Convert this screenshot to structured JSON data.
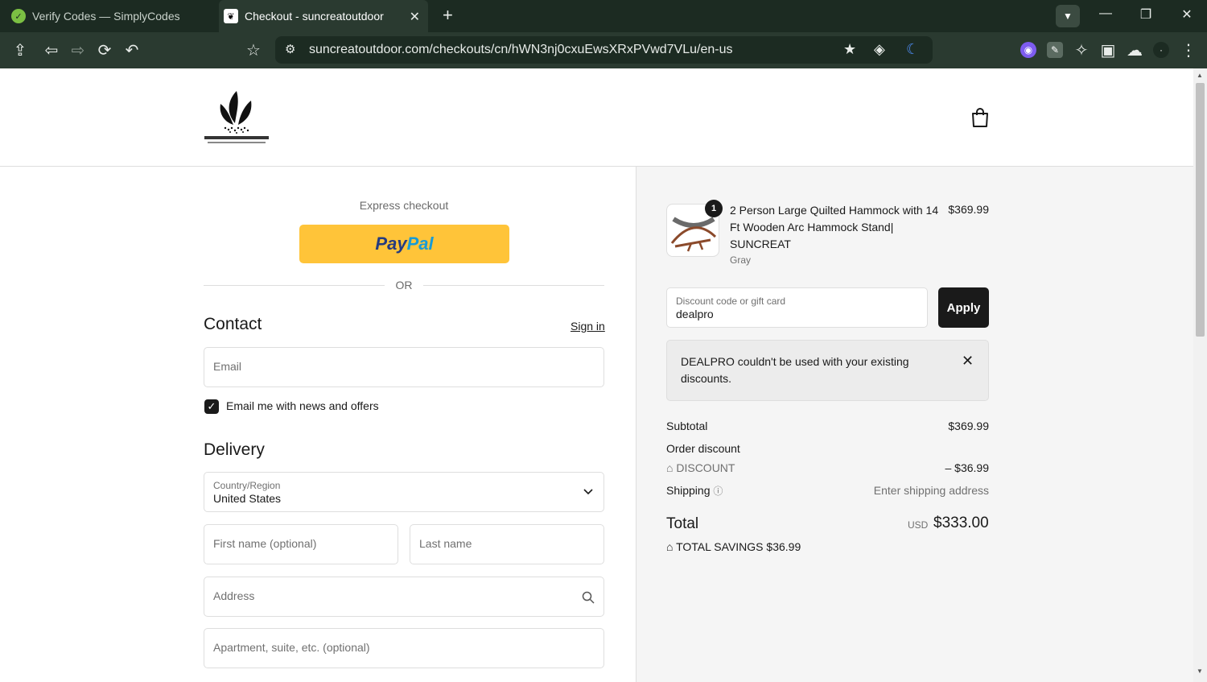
{
  "browser": {
    "tabs": [
      {
        "title": "Verify Codes — SimplyCodes",
        "active": false
      },
      {
        "title": "Checkout - suncreatoutdoor",
        "active": true
      }
    ],
    "url": "suncreatoutdoor.com/checkouts/cn/hWN3nj0cxuEwsXRxPVwd7VLu/en-us"
  },
  "checkout": {
    "express_title": "Express checkout",
    "paypal_part1": "Pay",
    "paypal_part2": "Pal",
    "or_label": "OR",
    "contact": {
      "title": "Contact",
      "sign_in": "Sign in",
      "email_placeholder": "Email",
      "newsletter_label": "Email me with news and offers",
      "newsletter_checked": true
    },
    "delivery": {
      "title": "Delivery",
      "country_label": "Country/Region",
      "country_value": "United States",
      "first_name_placeholder": "First name (optional)",
      "last_name_placeholder": "Last name",
      "address_placeholder": "Address",
      "apartment_placeholder": "Apartment, suite, etc. (optional)"
    }
  },
  "summary": {
    "product": {
      "quantity": "1",
      "name": "2 Person Large Quilted Hammock with 14 Ft Wooden Arc Hammock Stand| SUNCREAT",
      "variant": "Gray",
      "price": "$369.99"
    },
    "discount_field_label": "Discount code or gift card",
    "discount_field_value": "dealpro",
    "apply_label": "Apply",
    "notice": "DEALPRO couldn't be used with your existing discounts.",
    "subtotal_label": "Subtotal",
    "subtotal_value": "$369.99",
    "order_discount_label": "Order discount",
    "discount_name": "DISCOUNT",
    "discount_value": "– $36.99",
    "shipping_label": "Shipping",
    "shipping_value": "Enter shipping address",
    "total_label": "Total",
    "total_currency": "USD",
    "total_value": "$333.00",
    "savings_label": "TOTAL SAVINGS",
    "savings_value": "$36.99"
  }
}
